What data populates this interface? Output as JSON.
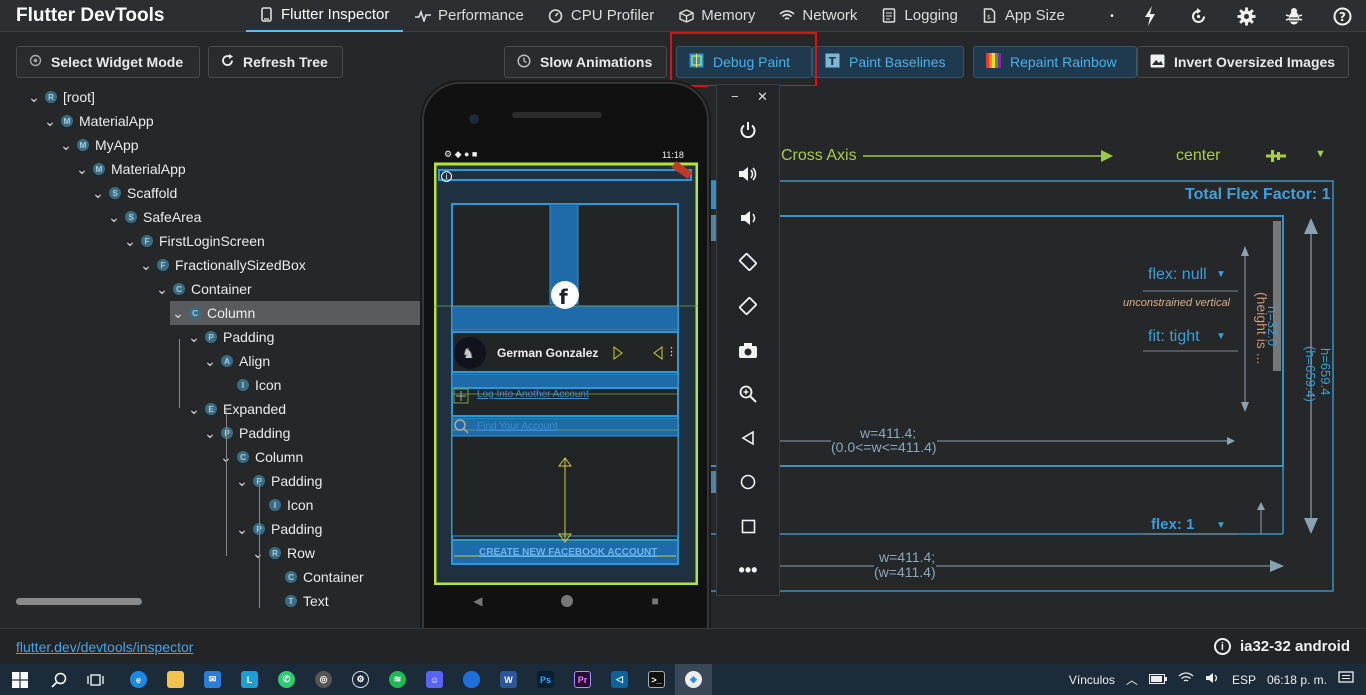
{
  "app": {
    "title": "Flutter DevTools"
  },
  "nav": {
    "tabs": [
      {
        "label": "Flutter Inspector",
        "icon": "phone-icon"
      },
      {
        "label": "Performance",
        "icon": "pulse-icon"
      },
      {
        "label": "CPU Profiler",
        "icon": "timer-icon"
      },
      {
        "label": "Memory",
        "icon": "memory-icon"
      },
      {
        "label": "Network",
        "icon": "network-icon"
      },
      {
        "label": "Logging",
        "icon": "log-icon"
      },
      {
        "label": "App Size",
        "icon": "file-size-icon"
      }
    ],
    "active_tab": "Flutter Inspector",
    "right_icons": [
      "hot-reload-icon",
      "hot-restart-icon",
      "settings-icon",
      "bug-icon",
      "help-icon"
    ]
  },
  "toolbar": {
    "select_widget_mode": "Select Widget Mode",
    "refresh_tree": "Refresh Tree",
    "slow_animations": "Slow Animations",
    "debug_paint": "Debug Paint",
    "paint_baselines": "Paint Baselines",
    "repaint_rainbow": "Repaint Rainbow",
    "invert_oversized_images": "Invert Oversized Images",
    "debug_paint_active": true,
    "repaint_rainbow_active": true
  },
  "tree": {
    "nodes": [
      {
        "label": "[root]",
        "badge": "R",
        "depth": 0,
        "expanded": true
      },
      {
        "label": "MaterialApp",
        "badge": "M",
        "depth": 1,
        "expanded": true
      },
      {
        "label": "MyApp",
        "badge": "M",
        "depth": 2,
        "expanded": true
      },
      {
        "label": "MaterialApp",
        "badge": "M",
        "depth": 3,
        "expanded": true
      },
      {
        "label": "Scaffold",
        "badge": "S",
        "depth": 4,
        "expanded": true
      },
      {
        "label": "SafeArea",
        "badge": "S",
        "depth": 5,
        "expanded": true
      },
      {
        "label": "FirstLoginScreen",
        "badge": "F",
        "depth": 6,
        "expanded": true
      },
      {
        "label": "FractionallySizedBox",
        "badge": "F",
        "depth": 7,
        "expanded": true
      },
      {
        "label": "Container",
        "badge": "C",
        "depth": 8,
        "expanded": true
      },
      {
        "label": "Column",
        "badge": "C",
        "depth": 9,
        "expanded": true,
        "selected": true
      },
      {
        "label": "Padding",
        "badge": "P",
        "depth": 10,
        "expanded": true
      },
      {
        "label": "Align",
        "badge": "A",
        "depth": 11,
        "expanded": true
      },
      {
        "label": "Icon",
        "badge": "I",
        "depth": 12,
        "expanded": false
      },
      {
        "label": "Expanded",
        "badge": "E",
        "depth": 10,
        "expanded": true
      },
      {
        "label": "Padding",
        "badge": "P",
        "depth": 11,
        "expanded": true
      },
      {
        "label": "Column",
        "badge": "C",
        "depth": 12,
        "expanded": true
      },
      {
        "label": "Padding",
        "badge": "P",
        "depth": 13,
        "expanded": true
      },
      {
        "label": "Icon",
        "badge": "I",
        "depth": 14,
        "expanded": false
      },
      {
        "label": "Padding",
        "badge": "P",
        "depth": 13,
        "expanded": true
      },
      {
        "label": "Row",
        "badge": "R",
        "depth": 14,
        "expanded": true
      },
      {
        "label": "Container",
        "badge": "C",
        "depth": 15,
        "expanded": false
      },
      {
        "label": "Text",
        "badge": "T",
        "depth": 15,
        "expanded": false
      }
    ]
  },
  "details": {
    "cross_axis_label": "Cross Axis",
    "cross_axis_value": "center",
    "total_flex_factor": "Total Flex Factor: 1",
    "flex_null": "flex: null",
    "unconstrained": "unconstrained vertical",
    "fit_tight": "fit: tight",
    "height_is": "(height is ...",
    "h_small": "h=32.0",
    "w_inner": "w=411.4;",
    "w_inner_range": "(0.0<=w<=411.4)",
    "flex_one": "flex: 1",
    "w_outer": "w=411.4;",
    "w_outer_paren": "(w=411.4)",
    "h_outer": "h=659.4",
    "h_outer_paren": "(h=659.4)"
  },
  "phone": {
    "time": "11:18",
    "name": "German Gonzalez",
    "log_into_another": "Log Into Another Account",
    "find_account": "Find Your Account",
    "create_account": "CREATE NEW FACEBOOK ACCOUNT"
  },
  "emulator": {
    "buttons": [
      "power-icon",
      "volume-up-icon",
      "volume-down-icon",
      "rotate-left-icon",
      "rotate-right-icon",
      "camera-icon",
      "zoom-icon",
      "back-icon",
      "home-icon",
      "overview-icon",
      "more-icon"
    ]
  },
  "status": {
    "link": "flutter.dev/devtools/inspector",
    "device": "ia32-32 android"
  },
  "taskbar": {
    "tray_label": "Vínculos",
    "language": "ESP",
    "clock": "06:18 p. m."
  }
}
